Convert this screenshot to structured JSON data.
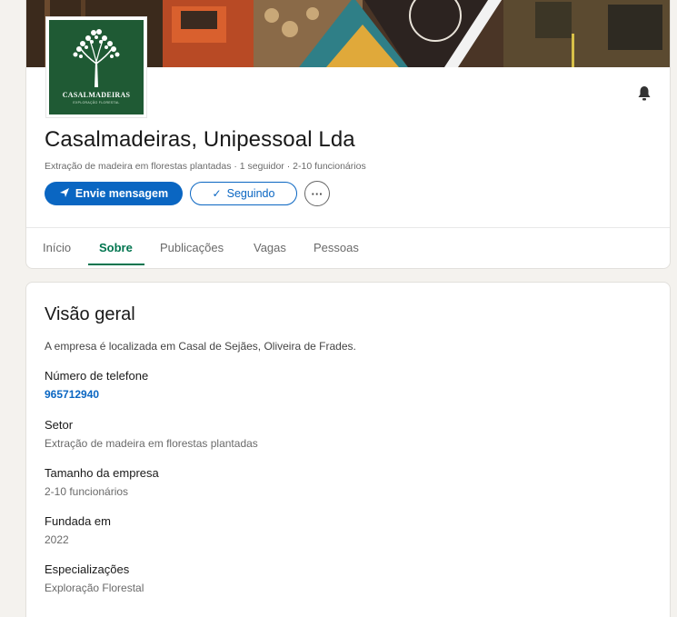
{
  "company": {
    "name": "Casalmadeiras, Unipessoal Lda",
    "meta": "Extração de madeira em florestas plantadas · 1 seguidor · 2-10 funcionários",
    "logo_text": "CASALMADEIRAS",
    "logo_subtext": "EXPLORAÇÃO FLORESTAL"
  },
  "actions": {
    "message": "Envie mensagem",
    "following": "Seguindo",
    "more": "···"
  },
  "tabs": [
    {
      "label": "Início",
      "active": false
    },
    {
      "label": "Sobre",
      "active": true
    },
    {
      "label": "Publicações",
      "active": false
    },
    {
      "label": "Vagas",
      "active": false
    },
    {
      "label": "Pessoas",
      "active": false
    }
  ],
  "about": {
    "title": "Visão geral",
    "description": "A empresa é localizada em Casal de Sejães, Oliveira de Frades.",
    "phone_label": "Número de telefone",
    "phone_value": "965712940",
    "sector_label": "Setor",
    "sector_value": "Extração de madeira em florestas plantadas",
    "size_label": "Tamanho da empresa",
    "size_value": "2-10 funcionários",
    "founded_label": "Fundada em",
    "founded_value": "2022",
    "specialties_label": "Especializações",
    "specialties_value": "Exploração Florestal"
  },
  "colors": {
    "primary": "#0a66c2",
    "active_tab": "#01754f",
    "logo_bg": "#1f5a34"
  }
}
